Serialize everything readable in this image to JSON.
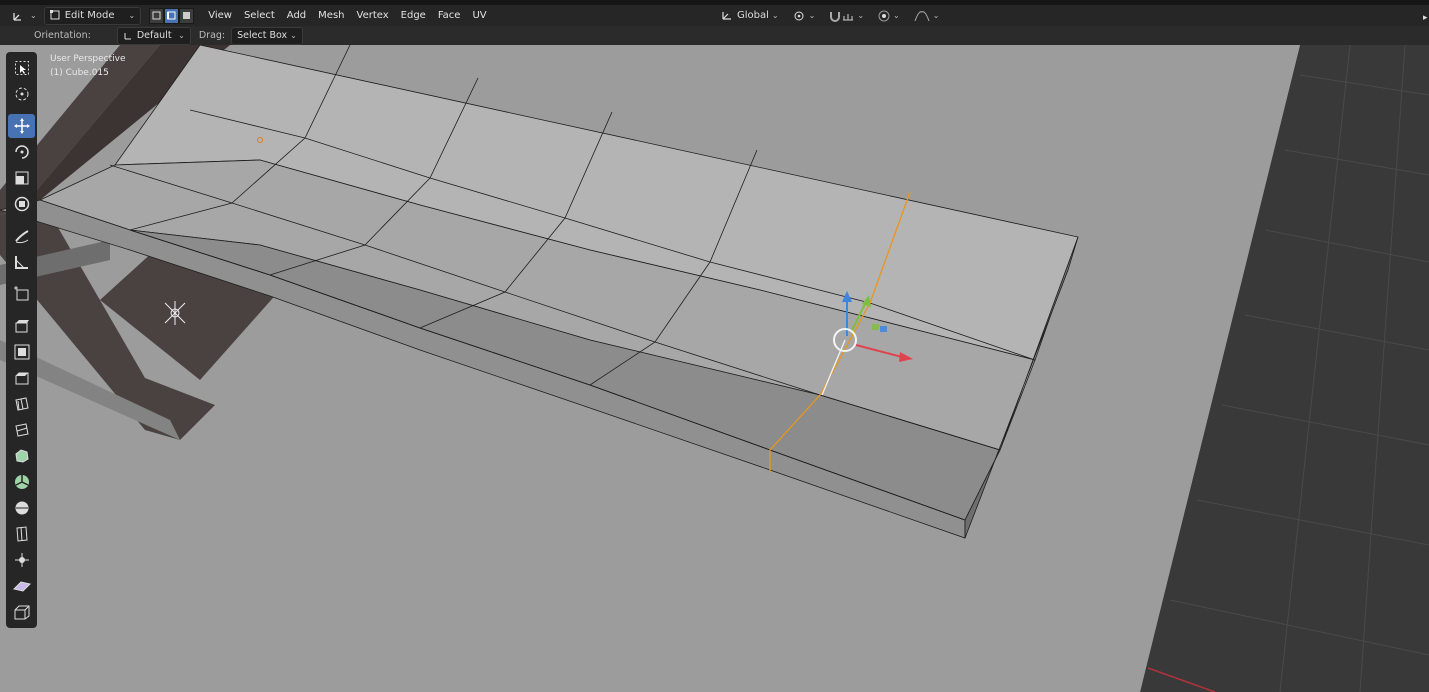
{
  "header": {
    "mode": "Edit Mode",
    "menu": [
      "View",
      "Select",
      "Add",
      "Mesh",
      "Vertex",
      "Edge",
      "Face",
      "UV"
    ],
    "transform_orientation": "Global"
  },
  "tool_settings": {
    "orientation_label": "Orientation:",
    "orientation_value": "Default",
    "drag_label": "Drag:",
    "drag_value": "Select Box"
  },
  "viewport": {
    "view_name": "User Perspective",
    "object_name": "(1) Cube.015"
  },
  "toolbar_icons": [
    "select-box-icon",
    "cursor-icon",
    "move-icon",
    "rotate-icon",
    "scale-icon",
    "transform-icon",
    "annotate-icon",
    "measure-icon",
    "add-cube-icon",
    "extrude-region-icon",
    "inset-faces-icon",
    "bevel-icon",
    "loop-cut-icon",
    "knife-icon",
    "poly-build-icon",
    "spin-icon",
    "smooth-icon",
    "edge-slide-icon",
    "shrink-fatten-icon",
    "shear-icon",
    "rip-region-icon"
  ],
  "colors": {
    "active_blue": "#4772b3",
    "selection_orange": "#e8961e",
    "gizmo_x": "#e0434e",
    "gizmo_y": "#7fbf3f",
    "gizmo_z": "#3d86e0"
  }
}
